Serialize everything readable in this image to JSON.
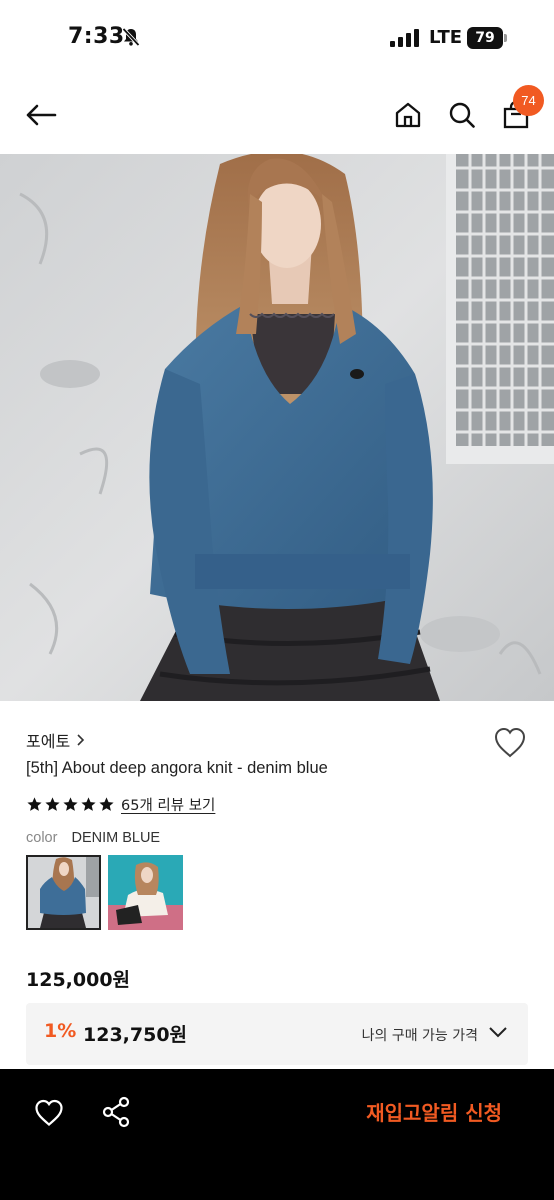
{
  "status_bar": {
    "time": "7:33",
    "network": "LTE",
    "battery": "79"
  },
  "nav": {
    "cart_count": "74"
  },
  "product": {
    "brand": "포에토",
    "title": "[5th] About deep angora knit - denim blue",
    "rating_stars": 5,
    "review_link": "65개 리뷰 보기",
    "color_label": "color",
    "color_value": "DENIM BLUE",
    "price": "125,000원",
    "discount_percent": "1%",
    "discount_price": "123,750원",
    "my_price_label": "나의 구매 가능 가격"
  },
  "bottom_bar": {
    "restock_label": "재입고알림 신청"
  },
  "colors": {
    "accent": "#f15a22",
    "sweater": "#3e6e98",
    "wall": "#d7d8d9"
  },
  "icons": [
    "bell-off-icon",
    "signal-icon",
    "battery-icon",
    "back-arrow-icon",
    "home-icon",
    "search-icon",
    "shopping-bag-icon",
    "chevron-right-icon",
    "heart-icon",
    "star-icon",
    "chevron-down-icon",
    "share-icon"
  ]
}
